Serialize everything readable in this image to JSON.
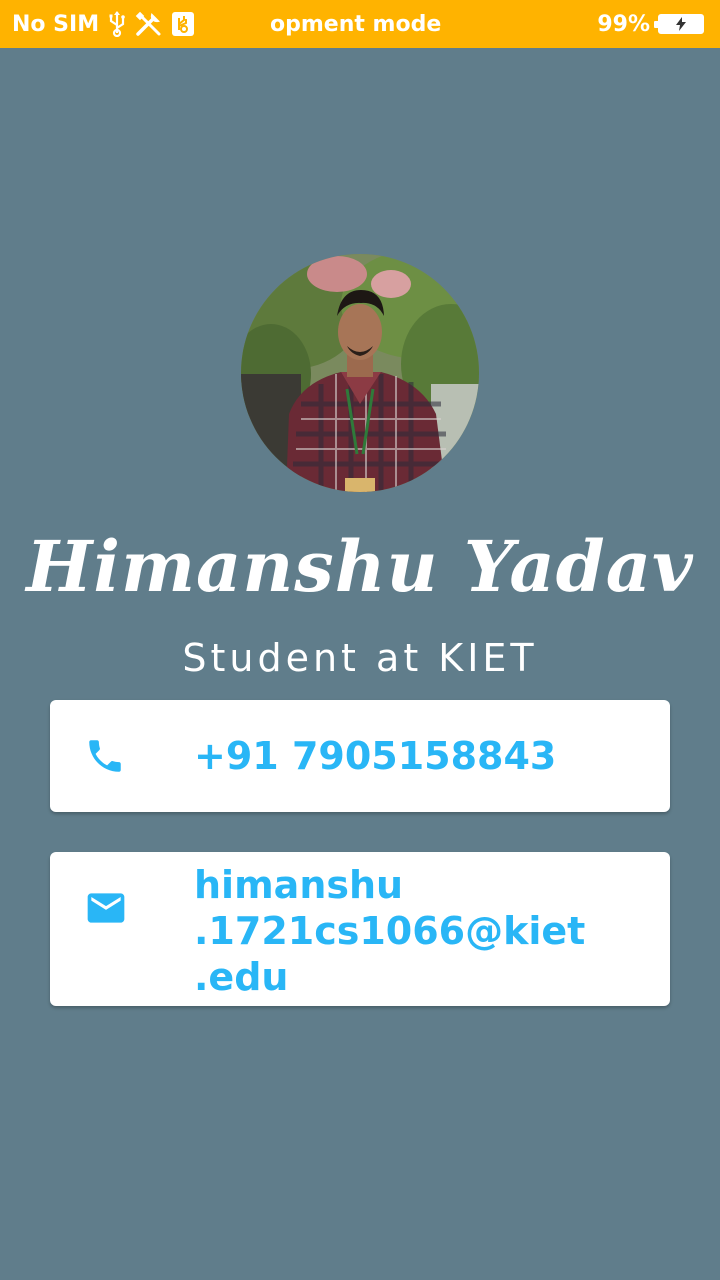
{
  "status_bar": {
    "carrier": "No SIM",
    "notification": "opment mode",
    "battery_percent": "99%",
    "icons": [
      "usb-icon",
      "tools-icon",
      "debug-icon",
      "battery-charging-icon"
    ]
  },
  "profile": {
    "name": "Himanshu Yadav",
    "subtitle": "Student at KIET"
  },
  "contacts": {
    "phone": "+91 7905158843",
    "email_lines": [
      "himanshu",
      ".1721cs1066@kiet",
      ".edu"
    ]
  },
  "colors": {
    "background": "#607D8B",
    "status_bar": "#FFB300",
    "accent": "#29B6F6",
    "card": "#FFFFFF"
  }
}
